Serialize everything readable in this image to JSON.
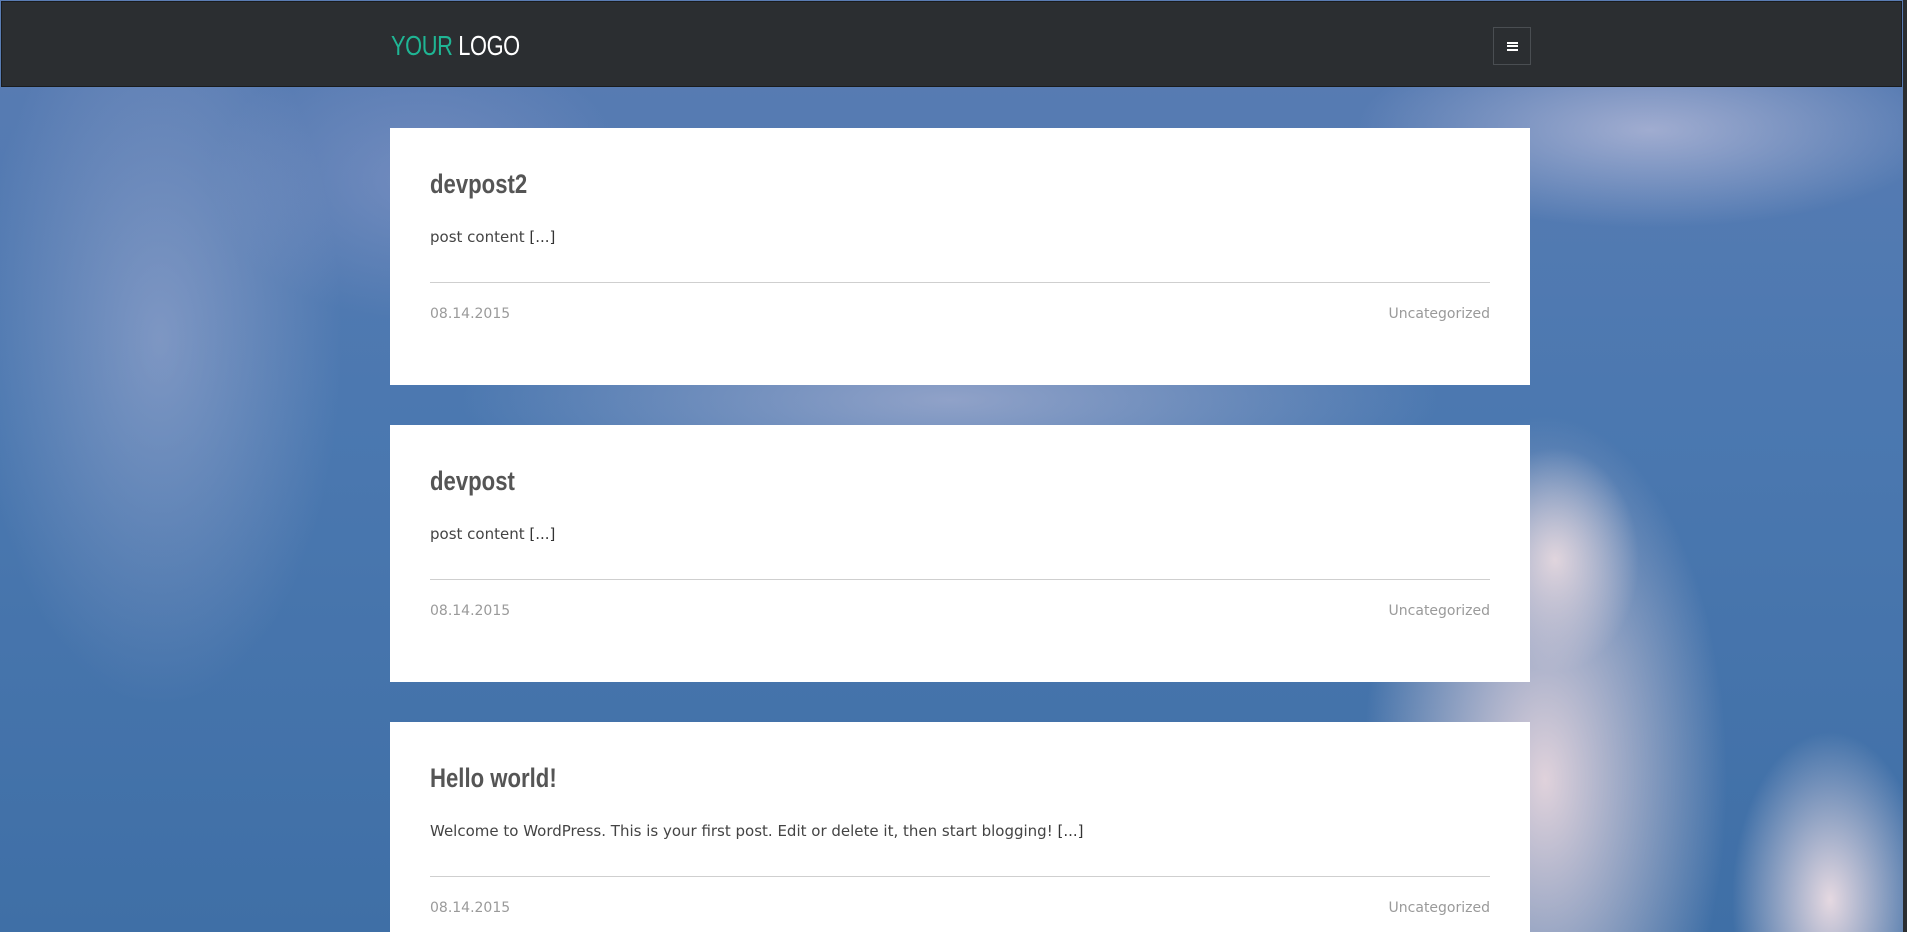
{
  "header": {
    "logo_accent": "YOUR",
    "logo_rest": "LOGO",
    "accent_color": "#1fb594",
    "background_color": "#2b2e31",
    "menu_icon": "hamburger-icon"
  },
  "posts": [
    {
      "title": "devpost2",
      "excerpt": "post content",
      "more": "[...]",
      "date": "08.14.2015",
      "category": "Uncategorized"
    },
    {
      "title": "devpost",
      "excerpt": "post content",
      "more": "[...]",
      "date": "08.14.2015",
      "category": "Uncategorized"
    },
    {
      "title": "Hello world!",
      "excerpt": "Welcome to WordPress. This is your first post. Edit or delete it, then start blogging!",
      "more": "[...]",
      "date": "08.14.2015",
      "category": "Uncategorized"
    }
  ]
}
